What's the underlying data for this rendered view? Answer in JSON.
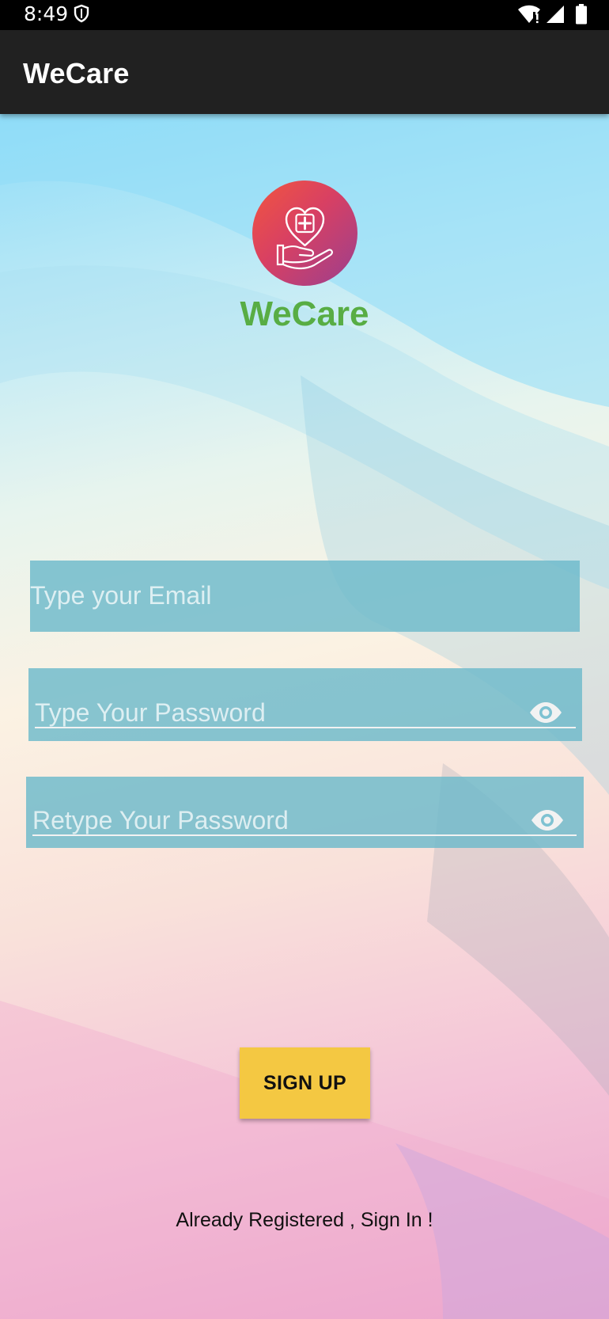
{
  "status_bar": {
    "time": "8:49",
    "icons": [
      "shield-icon",
      "wifi-icon",
      "signal-icon",
      "battery-icon"
    ]
  },
  "app_bar": {
    "title": "WeCare"
  },
  "brand": {
    "logo_icon": "heart-hand-medical-icon",
    "name": "WeCare",
    "name_color": "#58ad44"
  },
  "form": {
    "email": {
      "value": "",
      "placeholder": "Type your Email"
    },
    "password": {
      "value": "",
      "placeholder": "Type Your Password",
      "toggle_icon": "eye-icon"
    },
    "retype_password": {
      "value": "",
      "placeholder": "Retype Your Password",
      "toggle_icon": "eye-icon"
    }
  },
  "actions": {
    "signup_label": "SIGN UP",
    "signup_color": "#f4c842",
    "signin_link": "Already Registered , Sign In !"
  }
}
